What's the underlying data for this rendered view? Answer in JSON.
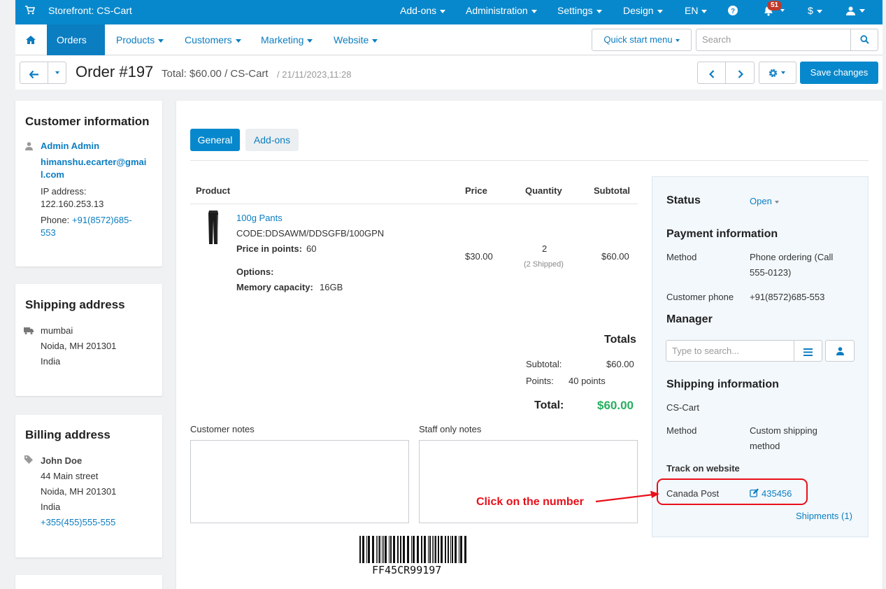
{
  "topbar": {
    "store_label": "Storefront: CS-Cart",
    "addons": "Add-ons",
    "administration": "Administration",
    "settings": "Settings",
    "design": "Design",
    "language": "EN",
    "notifications_count": "51",
    "currency": "$"
  },
  "nav": {
    "orders": "Orders",
    "products": "Products",
    "customers": "Customers",
    "marketing": "Marketing",
    "website": "Website",
    "quick_start": "Quick start menu",
    "search_placeholder": "Search"
  },
  "header": {
    "title": "Order #197",
    "total": "Total: $60.00 / CS-Cart",
    "date": "/ 21/11/2023,11:28",
    "save": "Save changes"
  },
  "customer": {
    "heading": "Customer information",
    "name": "Admin Admin",
    "email_line1": "himanshu.ecarter@gmai",
    "email_line2": "l.com",
    "ip_label": "IP address:",
    "ip_value": "122.160.253.13",
    "phone_label": "Phone:",
    "phone_line1": "+91(8572)685-",
    "phone_line2": "553"
  },
  "shipping_address": {
    "heading": "Shipping address",
    "line1": "mumbai",
    "line2": "Noida, MH 201301",
    "line3": "India"
  },
  "billing_address": {
    "heading": "Billing address",
    "name": "John Doe",
    "line1": "44 Main street",
    "line2": "Noida, MH 201301",
    "line3": "India",
    "phone": "+355(455)555-555"
  },
  "tabs": {
    "general": "General",
    "addons": "Add-ons"
  },
  "table": {
    "headers": {
      "product": "Product",
      "price": "Price",
      "quantity": "Quantity",
      "subtotal": "Subtotal"
    },
    "product_name": "100g Pants",
    "code": "CODE:DDSAWM/DDSGFB/100GPN",
    "points_label": "Price in points:",
    "points_value": "60",
    "options_label": "Options:",
    "memory_label": "Memory capacity:",
    "memory_value": "16GB",
    "price": "$30.00",
    "quantity": "2",
    "shipped": "(2 Shipped)",
    "subtotal": "$60.00"
  },
  "totals": {
    "heading": "Totals",
    "subtotal_label": "Subtotal:",
    "subtotal_value": "$60.00",
    "points_label": "Points:",
    "points_value": "40 points",
    "total_label": "Total:",
    "total_value": "$60.00"
  },
  "notes": {
    "customer": "Customer notes",
    "staff": "Staff only notes"
  },
  "barcode": "FF45CR99197",
  "side": {
    "status_label": "Status",
    "status_value": "Open",
    "payment_heading": "Payment information",
    "method_label": "Method",
    "method_value_l1": "Phone ordering (Call",
    "method_value_l2": "555-0123)",
    "cust_phone_label": "Customer phone",
    "cust_phone_value": "+91(8572)685-553",
    "manager_heading": "Manager",
    "manager_placeholder": "Type to search...",
    "shipping_heading": "Shipping information",
    "carrier_store": "CS-Cart",
    "ship_method_label": "Method",
    "ship_method_l1": "Custom shipping",
    "ship_method_l2": "method",
    "track_label": "Track on website",
    "carrier": "Canada Post",
    "tracking_number": "435456",
    "shipments": "Shipments (1)"
  },
  "annotation": {
    "text": "Click on the number",
    "color": "#e8101a"
  }
}
